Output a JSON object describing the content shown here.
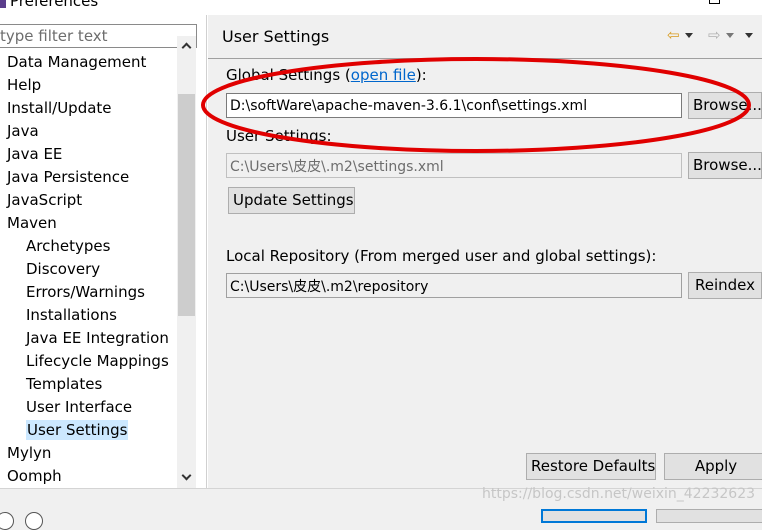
{
  "window": {
    "title": "Preferences",
    "app_icon": "eclipse-icon"
  },
  "left": {
    "filter_placeholder": "type filter text",
    "tree": [
      {
        "label": "Data Management",
        "level": 0
      },
      {
        "label": "Help",
        "level": 0
      },
      {
        "label": "Install/Update",
        "level": 0
      },
      {
        "label": "Java",
        "level": 0
      },
      {
        "label": "Java EE",
        "level": 0
      },
      {
        "label": "Java Persistence",
        "level": 0
      },
      {
        "label": "JavaScript",
        "level": 0
      },
      {
        "label": "Maven",
        "level": 0
      },
      {
        "label": "Archetypes",
        "level": 1
      },
      {
        "label": "Discovery",
        "level": 1
      },
      {
        "label": "Errors/Warnings",
        "level": 1
      },
      {
        "label": "Installations",
        "level": 1
      },
      {
        "label": "Java EE Integration",
        "level": 1
      },
      {
        "label": "Lifecycle Mappings",
        "level": 1
      },
      {
        "label": "Templates",
        "level": 1
      },
      {
        "label": "User Interface",
        "level": 1
      },
      {
        "label": "User Settings",
        "level": 1,
        "selected": true
      },
      {
        "label": "Mylyn",
        "level": 0
      },
      {
        "label": "Oomph",
        "level": 0
      }
    ]
  },
  "page": {
    "title": "User Settings",
    "nav": {
      "back_icon": "back-arrow-icon",
      "forward_icon": "forward-arrow-icon",
      "back_glyph": "⇦",
      "forward_glyph": "⇨"
    },
    "global_settings_prefix": "Global Settings (",
    "global_settings_link": "open file",
    "global_settings_suffix": "):",
    "global_settings_value": "D:\\softWare\\apache-maven-3.6.1\\conf\\settings.xml",
    "user_settings_label": "User Settings:",
    "user_settings_value": "C:\\Users\\皮皮\\.m2\\settings.xml",
    "browse_label": "Browse...",
    "update_settings_label": "Update Settings",
    "local_repo_label": "Local Repository (From merged user and global settings):",
    "local_repo_value": "C:\\Users\\皮皮\\.m2\\repository",
    "reindex_label": "Reindex",
    "restore_defaults_label": "Restore Defaults",
    "apply_label": "Apply"
  },
  "annotation": {
    "color": "#e00000"
  },
  "watermark": "https://blog.csdn.net/weixin_42232623"
}
